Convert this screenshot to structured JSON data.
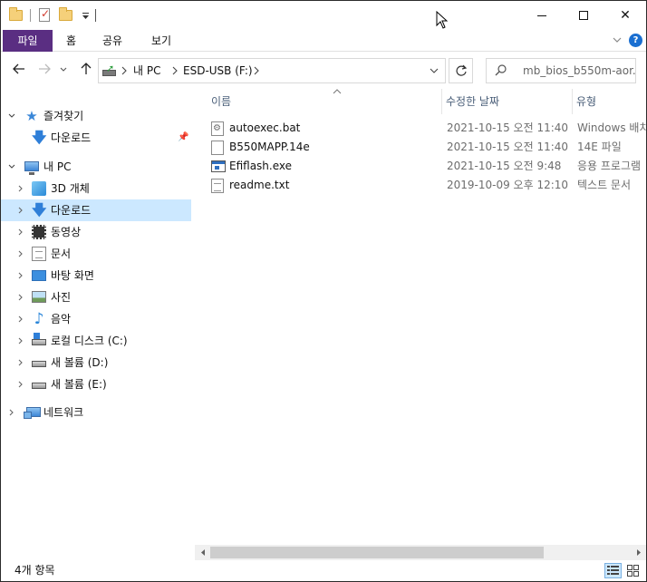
{
  "window": {
    "minimize_label": "",
    "maximize_label": "",
    "close_label": "✕"
  },
  "ribbon": {
    "tabs": [
      "파일",
      "홈",
      "공유",
      "보기"
    ]
  },
  "address": {
    "breadcrumbs": [
      "내 PC",
      "ESD-USB (F:)"
    ],
    "search_placeholder": "mb_bios_b550m-aor..."
  },
  "nav": {
    "quick_access": "즐겨찾기",
    "quick_downloads": "다운로드",
    "this_pc": "내 PC",
    "items": [
      "3D 개체",
      "다운로드",
      "동영상",
      "문서",
      "바탕 화면",
      "사진",
      "음악",
      "로컬 디스크 (C:)",
      "새 볼륨 (D:)",
      "새 볼륨 (E:)"
    ],
    "network": "네트워크"
  },
  "columns": {
    "name": "이름",
    "date": "수정한 날짜",
    "type": "유형"
  },
  "files": [
    {
      "name": "autoexec.bat",
      "date": "2021-10-15 오전 11:40",
      "type": "Windows 배치 파일",
      "icon": "batch-file-icon"
    },
    {
      "name": "B550MAPP.14e",
      "date": "2021-10-15 오전 11:40",
      "type": "14E 파일",
      "icon": "generic-file-icon"
    },
    {
      "name": "Efiflash.exe",
      "date": "2021-10-15 오전 9:48",
      "type": "응용 프로그램",
      "icon": "application-icon"
    },
    {
      "name": "readme.txt",
      "date": "2019-10-09 오후 12:10",
      "type": "텍스트 문서",
      "icon": "text-file-icon"
    }
  ],
  "status": {
    "item_count": "4개 항목"
  },
  "colors": {
    "file_tab": "#5a2e82",
    "selection": "#cce8ff",
    "accent": "#1a6fd1"
  }
}
